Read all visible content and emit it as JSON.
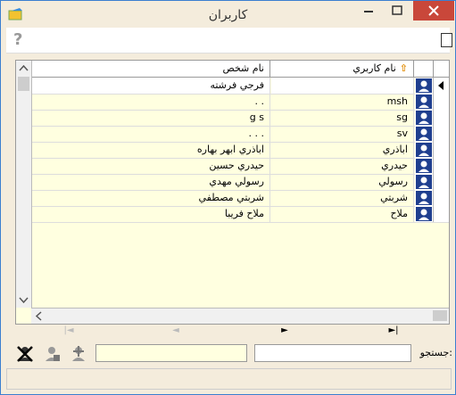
{
  "window": {
    "title": "كاربران",
    "colors": {
      "frame": "#3a7fd0",
      "close": "#c9473a",
      "grid_bg": "#ffffe0",
      "window_bg": "#f4ecdc"
    }
  },
  "toolbar": {
    "help_icon": "help-icon"
  },
  "grid": {
    "columns": {
      "user_name": "نام كاربري",
      "person_name": "نام شخص"
    },
    "sort": {
      "column": "user_name",
      "direction": "ascending"
    },
    "rows": [
      {
        "user_name": "",
        "person_name": "فرجي فرشته",
        "active": true
      },
      {
        "user_name": "msh",
        "person_name": ". ."
      },
      {
        "user_name": "sg",
        "person_name": "g s"
      },
      {
        "user_name": "sv",
        "person_name": ". . ."
      },
      {
        "user_name": "اباذري",
        "person_name": "اباذري ابهر بهاره"
      },
      {
        "user_name": "حيدري",
        "person_name": "حيدري حسين"
      },
      {
        "user_name": "رسولي",
        "person_name": "رسولي مهدي"
      },
      {
        "user_name": "شربتي",
        "person_name": "شربتي مصطفي"
      },
      {
        "user_name": "ملاح",
        "person_name": "ملاح فريبا"
      }
    ]
  },
  "navigation": {
    "prev_label": "◄",
    "next_label": "►",
    "last_label": "►|",
    "first_label": "|◄"
  },
  "search": {
    "label": "جستجو:",
    "value": "",
    "filter_value": ""
  }
}
